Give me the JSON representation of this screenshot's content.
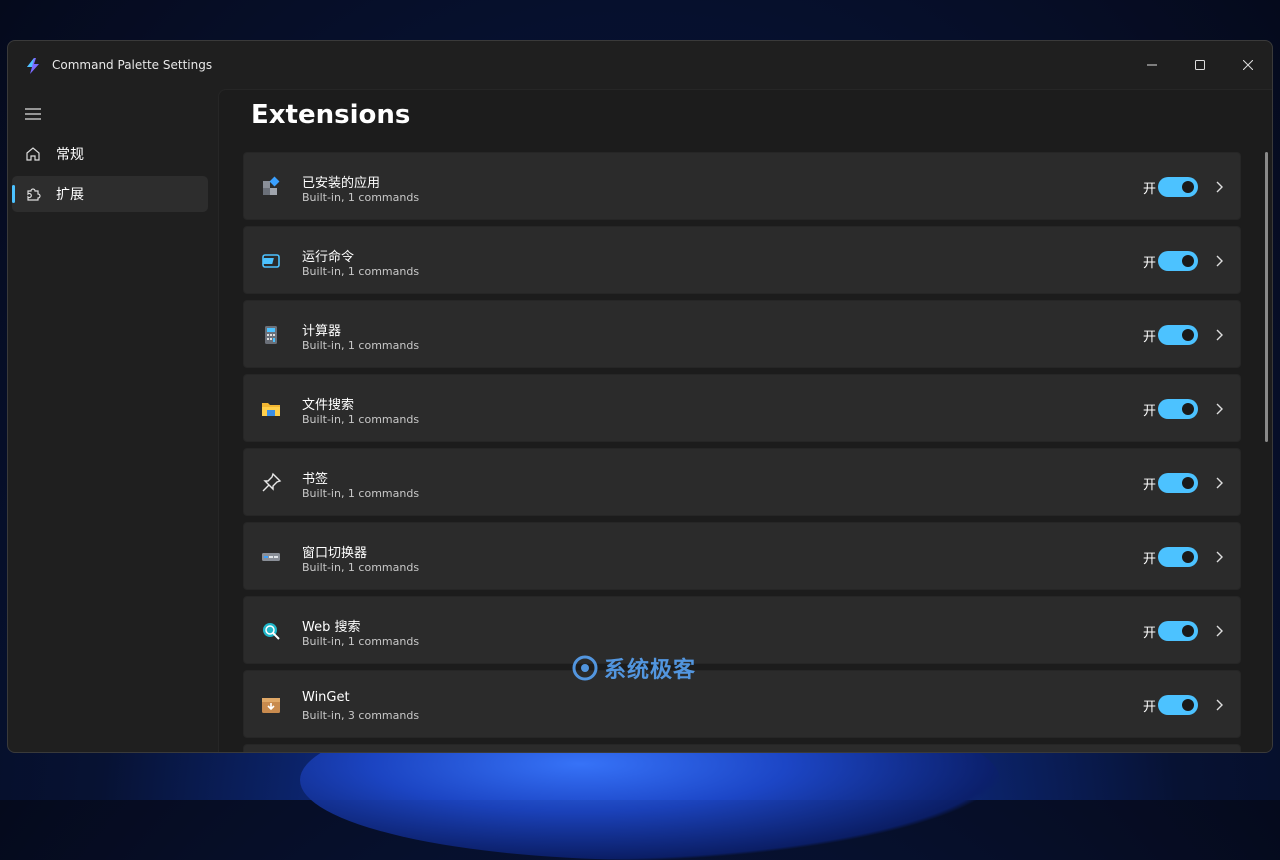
{
  "window": {
    "title": "Command Palette Settings"
  },
  "nav": {
    "items": [
      {
        "label": "常规",
        "icon": "home-icon",
        "selected": false
      },
      {
        "label": "扩展",
        "icon": "puzzle-icon",
        "selected": true
      }
    ]
  },
  "page": {
    "title": "Extensions"
  },
  "extensions": [
    {
      "name": "已安装的应用",
      "subtitle": "Built-in, 1 commands",
      "state": "开",
      "icon": "apps-icon"
    },
    {
      "name": "运行命令",
      "subtitle": "Built-in, 1 commands",
      "state": "开",
      "icon": "run-icon"
    },
    {
      "name": "计算器",
      "subtitle": "Built-in, 1 commands",
      "state": "开",
      "icon": "calculator-icon"
    },
    {
      "name": "文件搜索",
      "subtitle": "Built-in, 1 commands",
      "state": "开",
      "icon": "folder-icon"
    },
    {
      "name": "书签",
      "subtitle": "Built-in, 1 commands",
      "state": "开",
      "icon": "pin-icon"
    },
    {
      "name": "窗口切换器",
      "subtitle": "Built-in, 1 commands",
      "state": "开",
      "icon": "window-switcher-icon"
    },
    {
      "name": "Web 搜索",
      "subtitle": "Built-in, 1 commands",
      "state": "开",
      "icon": "web-search-icon"
    },
    {
      "name": "WinGet",
      "subtitle": "Built-in, 3 commands",
      "state": "开",
      "icon": "package-icon"
    }
  ],
  "watermark": {
    "text": "系统极客"
  },
  "colors": {
    "accent": "#4cc2ff",
    "window_bg": "#1f1f1f",
    "card_bg": "#2b2b2b"
  }
}
